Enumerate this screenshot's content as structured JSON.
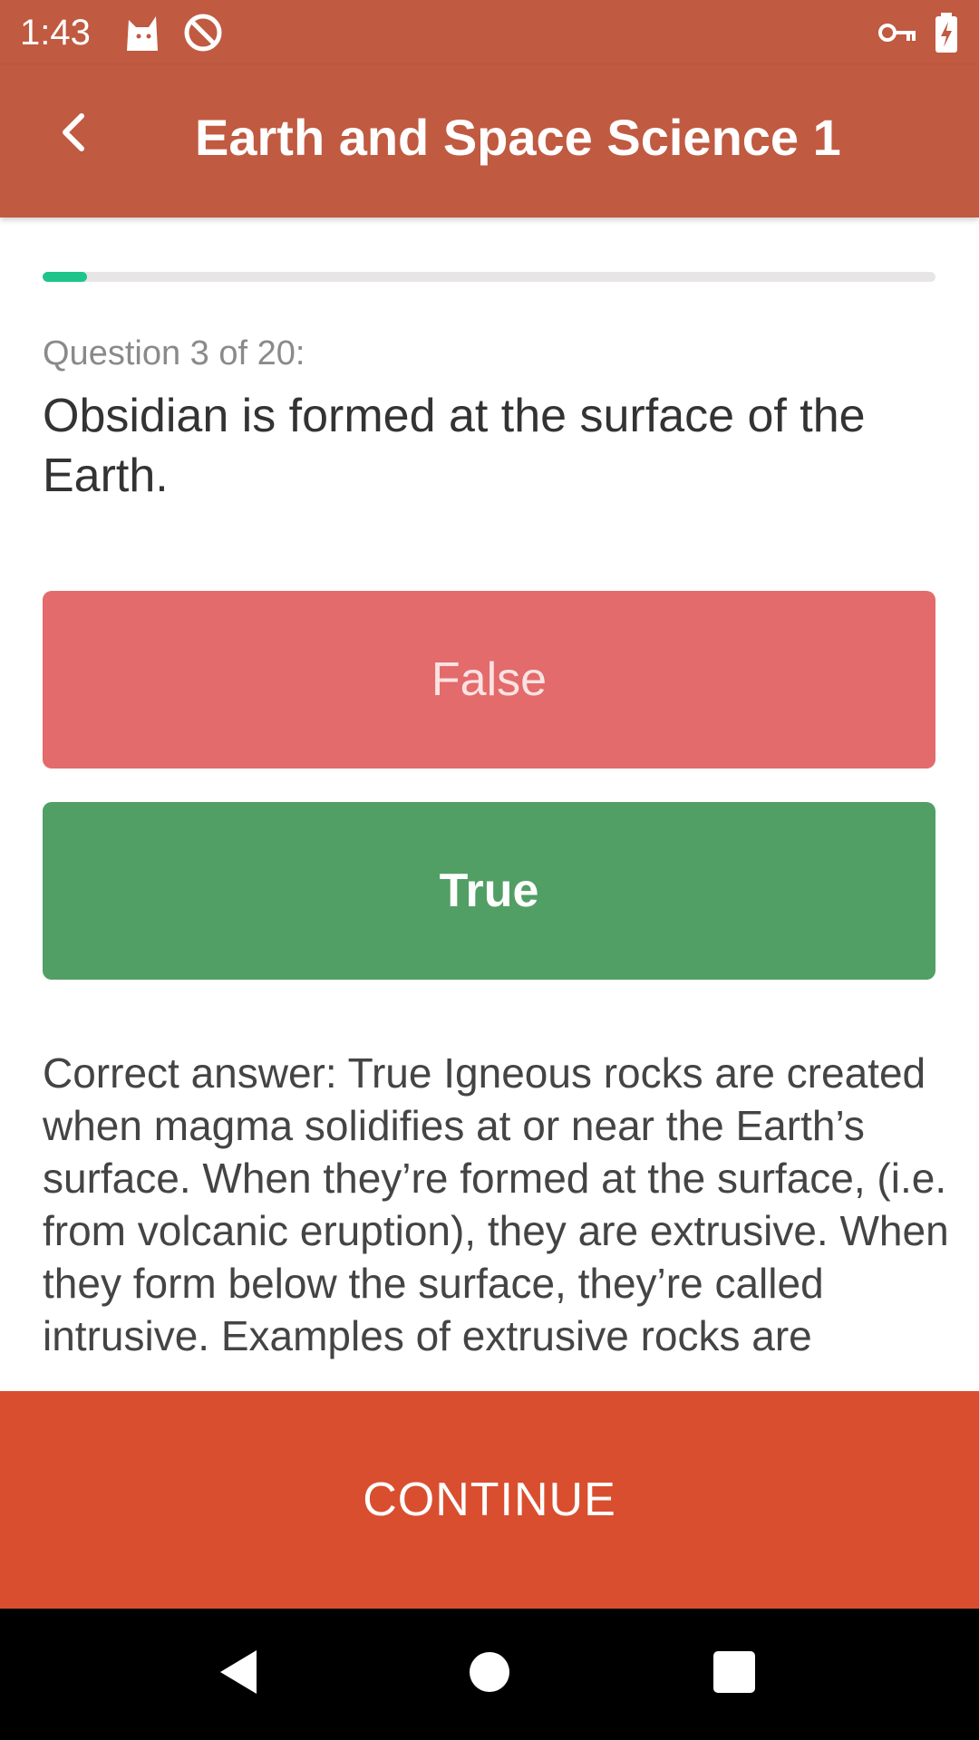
{
  "status_bar": {
    "time": "1:43",
    "icons": [
      "cat-icon",
      "no-disturb-icon",
      "vpn-key-icon",
      "battery-charging-icon"
    ]
  },
  "app_bar": {
    "title": "Earth and Space Science 1",
    "back_icon": "chevron-left-icon"
  },
  "progress": {
    "current": 3,
    "total": 20,
    "fill_fraction": 0.05,
    "color": "#1dc58a"
  },
  "question": {
    "counter": "Question 3 of 20:",
    "text": "Obsidian is formed at the surface of the Earth."
  },
  "answers": {
    "false_label": "False",
    "true_label": "True"
  },
  "explanation": "Correct answer: True Igneous rocks are created when magma solidifies at or near the Earth’s surface. When they’re formed at the surface, (i.e. from volcanic eruption), they are extrusive. When they form below the surface, they’re called intrusive. Examples of extrusive rocks are",
  "continue_label": "CONTINUE",
  "colors": {
    "header": "#c05a41",
    "false_button": "#e36b6b",
    "true_button": "#519f64",
    "continue_button": "#d94e2f"
  },
  "nav_bar": {
    "icons": [
      "back-triangle-icon",
      "home-circle-icon",
      "recents-square-icon"
    ]
  }
}
